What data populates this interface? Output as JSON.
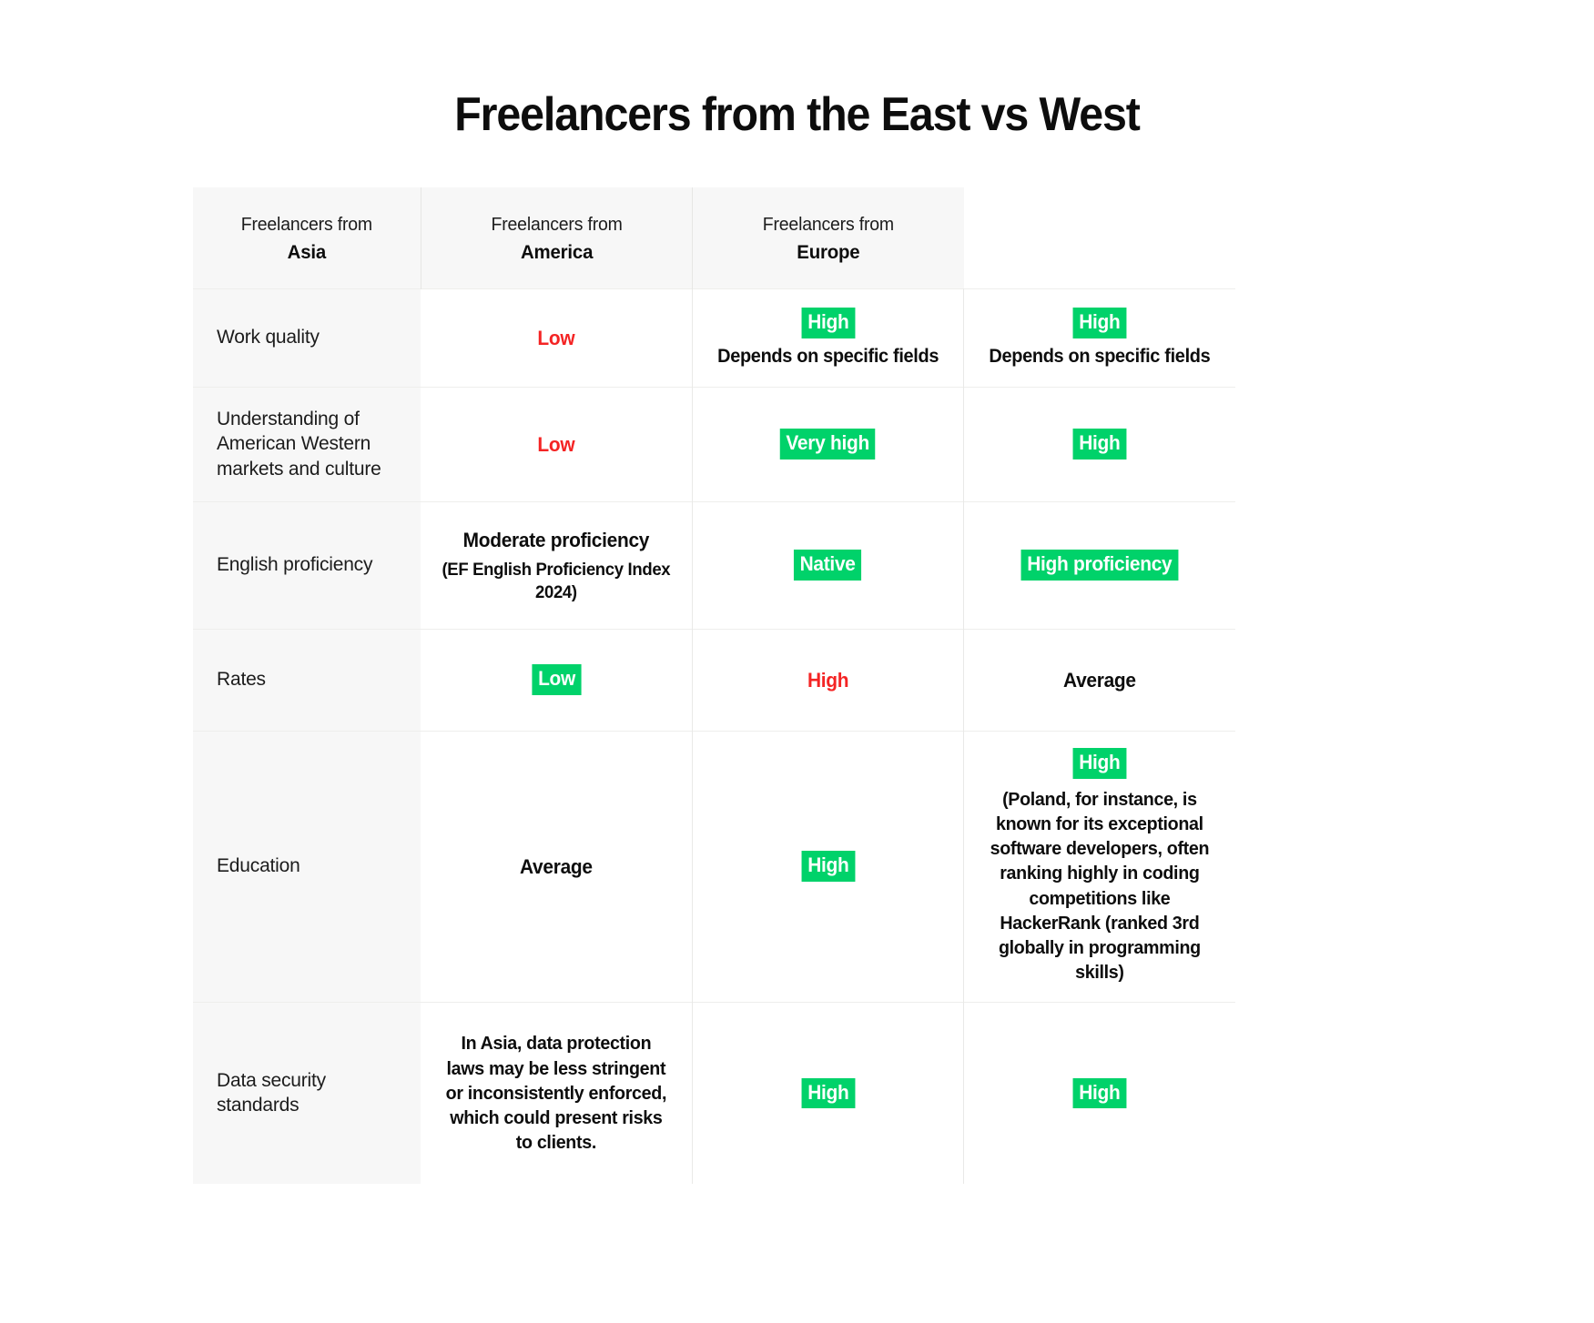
{
  "page": {
    "title": "Freelancers from the East vs West"
  },
  "colors": {
    "green_badge": "#00d26a",
    "red_text": "#f42424",
    "header_bg": "#f7f7f7",
    "label_bg": "#f7f7f7",
    "text": "#0d0d0d",
    "border": "#e9e9e7"
  },
  "table": {
    "header": {
      "blank": "",
      "columns": [
        {
          "prefix": "Freelancers from",
          "region": "Asia"
        },
        {
          "prefix": "Freelancers from",
          "region": "America"
        },
        {
          "prefix": "Freelancers from",
          "region": "Europe"
        }
      ]
    },
    "rows": [
      {
        "label": "Work quality",
        "asia": {
          "badge": "",
          "value": "Low",
          "note": ""
        },
        "america": {
          "badge": "High",
          "value": "",
          "note": "Depends on specific fields"
        },
        "europe": {
          "badge": "High",
          "value": "",
          "note": "Depends on specific fields"
        }
      },
      {
        "label": "Understanding of American Western markets and culture",
        "asia": {
          "badge": "",
          "value": "Low",
          "note": ""
        },
        "america": {
          "badge": "Very high",
          "value": "",
          "note": ""
        },
        "europe": {
          "badge": "High",
          "value": "",
          "note": ""
        }
      },
      {
        "label": "English proficiency",
        "asia": {
          "badge": "",
          "value": "Moderate proficiency",
          "note": "(EF English Proficiency Index 2024)"
        },
        "america": {
          "badge": "Native",
          "value": "",
          "note": ""
        },
        "europe": {
          "badge": "High proficiency",
          "value": "",
          "note": ""
        }
      },
      {
        "label": "Rates",
        "asia": {
          "badge": "Low",
          "value": "",
          "note": ""
        },
        "america": {
          "badge": "",
          "value": "High",
          "note": ""
        },
        "europe": {
          "badge": "",
          "value": "Average",
          "note": ""
        }
      },
      {
        "label": "Education",
        "asia": {
          "badge": "",
          "value": "Average",
          "note": ""
        },
        "america": {
          "badge": "High",
          "value": "",
          "note": ""
        },
        "europe": {
          "badge": "High",
          "value": "",
          "note": "(Poland, for instance, is known for its exceptional software developers, often ranking highly in coding competitions like HackerRank (ranked 3rd globally in programming skills)"
        }
      },
      {
        "label": "Data security standards",
        "asia": {
          "badge": "",
          "value": "",
          "note": "In Asia, data protection laws may be less stringent or inconsistently enforced, which could present risks to clients."
        },
        "america": {
          "badge": "High",
          "value": "",
          "note": ""
        },
        "europe": {
          "badge": "High",
          "value": "",
          "note": ""
        }
      }
    ]
  }
}
